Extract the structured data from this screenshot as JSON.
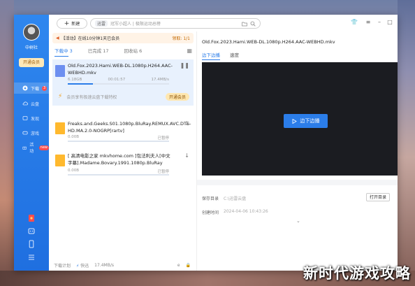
{
  "app": {
    "new_button_label": "新建",
    "search_tag": "迅雷",
    "search_placeholder": "冠军小超人 | 极限运动总榜",
    "window_controls": [
      "shirt-icon",
      "menu",
      "minimize",
      "maximize",
      "close"
    ]
  },
  "sidebar": {
    "username": "中树社",
    "vip_label": "开通会员",
    "items": [
      {
        "label": "下载",
        "badge": "3",
        "icon": "download-icon",
        "active": true
      },
      {
        "label": "云盘",
        "icon": "cloud-icon"
      },
      {
        "label": "发现",
        "icon": "discover-icon"
      },
      {
        "label": "游戏",
        "icon": "gamepad-icon"
      },
      {
        "label": "活动",
        "badge": "new",
        "icon": "gift-icon"
      }
    ],
    "bottom_icons": [
      "red-envelope-icon",
      "robot-icon",
      "phone-icon",
      "hamburger-icon"
    ]
  },
  "download_panel": {
    "notice": {
      "text": "【活动】在线10分钟1天已会员",
      "action": "领取: 1/1"
    },
    "tabs": [
      "下载中 3",
      "已完成 17",
      "回收站 6"
    ],
    "items": [
      {
        "name": "Old.Fox.2023.Hami.WEB-DL.1080p.H264.AAC-WEBHD.mkv",
        "size": "6.18GB",
        "time": "00:01:57",
        "speed": "17.4MB/s",
        "progress": 0.25,
        "type": "video",
        "selected": true
      },
      {
        "name": "Freaks.and.Geeks.S01.1080p.BluRay.REMUX.AVC.DTS-HD.MA.2.0-NOGRP[rartv]",
        "size": "0.00B",
        "time": "",
        "speed": "已暂停",
        "progress": 0.0,
        "type": "folder"
      },
      {
        "name": "[ 高清电影之家 mkvhome.com ]包法利夫人[中文字幕].Madame.Bovary.1991.1080p.BluRay",
        "size": "0.00B",
        "time": "",
        "speed": "已暂停",
        "progress": 0.0,
        "type": "folder"
      }
    ],
    "speed_hint": "会员享有极速云盘下载特权",
    "speed_vip_label": "开通会员",
    "footer": {
      "plan": "下载计划",
      "speed_label": "快迅",
      "speed": "17.4MB/s"
    }
  },
  "detail": {
    "title": "Old.Fox.2023.Hami.WEB-DL.1080p.H264.AAC-WEBHD.mkv",
    "tabs": [
      "边下边播",
      "速度"
    ],
    "play_label": "边下边播",
    "save_dir_label": "保存目录",
    "save_dir_value": "C:\\迅雷云盘",
    "open_dir_label": "打开目录",
    "created_label": "创建时间",
    "created_value": "2024-04-06 10:43:26"
  },
  "watermark": "新时代游戏攻略"
}
